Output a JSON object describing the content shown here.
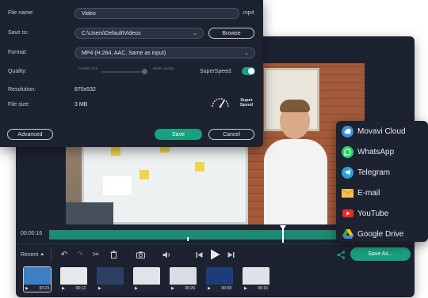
{
  "dialog": {
    "file_name_label": "File name:",
    "file_name_value": "Video",
    "extension": ".mp4",
    "save_to_label": "Save to:",
    "save_to_value": "C:\\Users\\Default\\Videos",
    "browse_label": "Browse",
    "format_label": "Format:",
    "format_value": "MP4 (H.264, AAC, Same as input)",
    "quality_label": "Quality:",
    "quality_smaller": "Smaller size",
    "quality_better": "Better quality",
    "superspeed_label": "SuperSpeed:",
    "superspeed_on": true,
    "resolution_label": "Resolution:",
    "resolution_value": "870x532",
    "file_size_label": "File size:",
    "file_size_value": "3 MB",
    "super_speed_badge": "Super Speed",
    "advanced_label": "Advanced",
    "save_label": "Save",
    "cancel_label": "Cancel"
  },
  "editor": {
    "time": "00:00:16",
    "recent_label": "Recent",
    "save_as_label": "Save As...",
    "thumbnails": [
      {
        "duration": "00:23",
        "active": true
      },
      {
        "duration": "00:13",
        "active": false
      },
      {
        "duration": "",
        "active": false
      },
      {
        "duration": "",
        "active": false
      },
      {
        "duration": "00:26",
        "active": false
      },
      {
        "duration": "00:08",
        "active": false
      },
      {
        "duration": "00:16",
        "active": false
      }
    ]
  },
  "share_menu": {
    "items": [
      {
        "label": "Movavi Cloud",
        "icon": "cloud-icon",
        "color": "#3b8fe0"
      },
      {
        "label": "WhatsApp",
        "icon": "whatsapp-icon",
        "color": "#25d366"
      },
      {
        "label": "Telegram",
        "icon": "telegram-icon",
        "color": "#2aa1da"
      },
      {
        "label": "E-mail",
        "icon": "email-icon",
        "color": "#f2c14e"
      },
      {
        "label": "YouTube",
        "icon": "youtube-icon",
        "color": "#e52d27"
      },
      {
        "label": "Google Drive",
        "icon": "google-drive-icon",
        "color": "#34a853"
      }
    ]
  },
  "colors": {
    "accent": "#19a07e",
    "panel": "#1d2230"
  }
}
